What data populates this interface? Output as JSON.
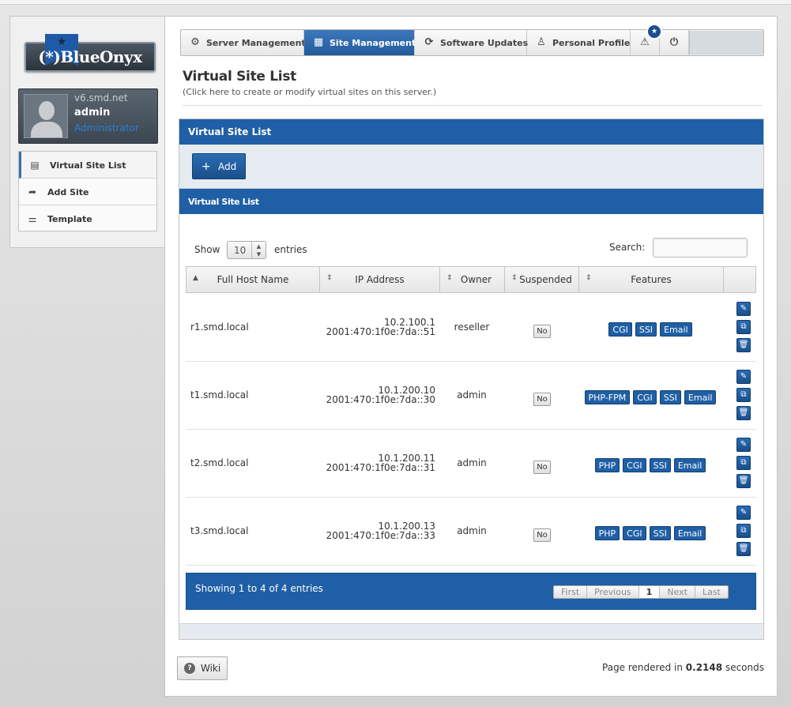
{
  "brand": {
    "logo_text": "(*)BlueOnyx"
  },
  "user": {
    "host": "v6.smd.net",
    "name": "admin",
    "role": "Administrator"
  },
  "sidebar": {
    "items": [
      {
        "label": "Virtual Site List",
        "icon": "list-layout-icon",
        "active": true
      },
      {
        "label": "Add Site",
        "icon": "share-arrow-icon",
        "active": false
      },
      {
        "label": "Template",
        "icon": "sliders-icon",
        "active": false
      }
    ]
  },
  "topnav": {
    "tabs": [
      {
        "label": "Server Management",
        "icon": "gear-icon",
        "active": false
      },
      {
        "label": "Site Management",
        "icon": "layout-icon",
        "active": true
      },
      {
        "label": "Software Updates",
        "icon": "refresh-icon",
        "active": false
      },
      {
        "label": "Personal Profile",
        "icon": "user-icon",
        "active": false
      }
    ],
    "alert_icon": "warning-icon",
    "logout_icon": "logout-icon",
    "badge": "★"
  },
  "page": {
    "title": "Virtual Site List",
    "subtitle": "(Click here to create or modify virtual sites on this server.)"
  },
  "panel": {
    "header": "Virtual Site List",
    "add_label": "Add",
    "subheader": "Virtual Site List"
  },
  "table": {
    "show_label": "Show",
    "show_value": "10",
    "entries_label": "entries",
    "search_label": "Search:",
    "search_value": "",
    "columns": [
      "Full Host Name",
      "IP Address",
      "Owner",
      "Suspended",
      "Features"
    ],
    "rows": [
      {
        "host": "r1.smd.local",
        "ip": [
          "10.2.100.1",
          "2001:470:1f0e:7da::51"
        ],
        "owner": "reseller",
        "suspended": "No",
        "features": [
          "CGI",
          "SSI",
          "Email"
        ]
      },
      {
        "host": "t1.smd.local",
        "ip": [
          "10.1.200.10",
          "2001:470:1f0e:7da::30"
        ],
        "owner": "admin",
        "suspended": "No",
        "features": [
          "PHP-FPM",
          "CGI",
          "SSI",
          "Email"
        ]
      },
      {
        "host": "t2.smd.local",
        "ip": [
          "10.1.200.11",
          "2001:470:1f0e:7da::31"
        ],
        "owner": "admin",
        "suspended": "No",
        "features": [
          "PHP",
          "CGI",
          "SSI",
          "Email"
        ]
      },
      {
        "host": "t3.smd.local",
        "ip": [
          "10.1.200.13",
          "2001:470:1f0e:7da::33"
        ],
        "owner": "admin",
        "suspended": "No",
        "features": [
          "PHP",
          "CGI",
          "SSI",
          "Email"
        ]
      }
    ],
    "info": "Showing 1 to 4 of 4 entries",
    "pager": [
      "First",
      "Previous",
      "1",
      "Next",
      "Last"
    ],
    "current_page": "1"
  },
  "footer": {
    "wiki_label": "Wiki",
    "rendered_prefix": "Page rendered in",
    "rendered_time": "0.2148",
    "rendered_suffix": "seconds"
  },
  "colors": {
    "accent": "#1f5fa5",
    "nav_active": "#2f6bb0"
  }
}
